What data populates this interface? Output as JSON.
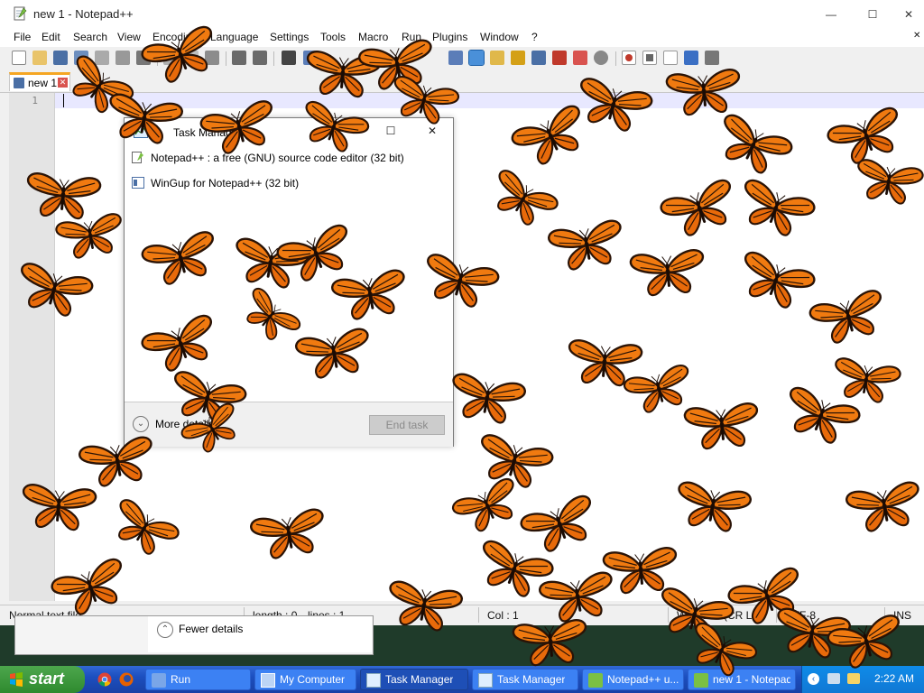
{
  "window": {
    "title": "new 1 - Notepad++",
    "minimize_glyph": "—",
    "maximize_glyph": "☐",
    "close_glyph": "✕"
  },
  "menu": [
    "File",
    "Edit",
    "Search",
    "View",
    "Encoding",
    "Language",
    "Settings",
    "Tools",
    "Macro",
    "Run",
    "Plugins",
    "Window",
    "?"
  ],
  "menu_close_glyph": "✕",
  "tab": {
    "label": "new 1",
    "close_glyph": "✕"
  },
  "editor": {
    "line_numbers": [
      "1"
    ],
    "text": ""
  },
  "statusbar": {
    "type": "Normal text file",
    "length": "length : 0",
    "lines": "lines : 1",
    "col": "Col : 1",
    "eol": "Windows (CR LF)",
    "encoding": "UTF-8",
    "mode": "INS"
  },
  "task_manager": {
    "title": "Task Manager",
    "processes": [
      {
        "name": "Notepad++ : a free (GNU) source code editor (32 bit)",
        "icon": "notepad-plus-icon"
      },
      {
        "name": "WinGup for Notepad++ (32 bit)",
        "icon": "wingup-icon"
      }
    ],
    "more_details": "More details",
    "end_task": "End task",
    "minimize_glyph": "—",
    "maximize_glyph": "☐",
    "close_glyph": "✕",
    "chevron_glyph": "⌄"
  },
  "task_manager_bg": {
    "fewer_details": "Fewer details",
    "chevron_glyph": "⌃"
  },
  "taskbar": {
    "start_label": "start",
    "quicklaunch": [
      "chrome-icon",
      "firefox-icon"
    ],
    "tasks": [
      {
        "label": "Run",
        "icon": "run-icon",
        "active": false
      },
      {
        "label": "My Computer",
        "icon": "my-computer-icon",
        "active": false
      },
      {
        "label": "Task Manager",
        "icon": "task-manager-icon",
        "active": true
      },
      {
        "label": "Task Manager",
        "icon": "task-manager-icon",
        "active": false
      },
      {
        "label": "Notepad++ u...",
        "icon": "notepad-plus-icon",
        "active": false
      },
      {
        "label": "new 1 - Notepad++",
        "icon": "notepad-plus-icon",
        "active": false
      }
    ],
    "tray_chevron": "‹",
    "clock": "2:22 AM"
  },
  "colors": {
    "butterfly_orange": "#f07a10",
    "butterfly_vein": "#2a1306",
    "accent_tab": "#f5a623",
    "taskbar_blue": "#2559c8",
    "start_green": "#3a9a3a"
  },
  "butterflies": {
    "count": 60,
    "icon": "monarch-butterfly-icon"
  }
}
